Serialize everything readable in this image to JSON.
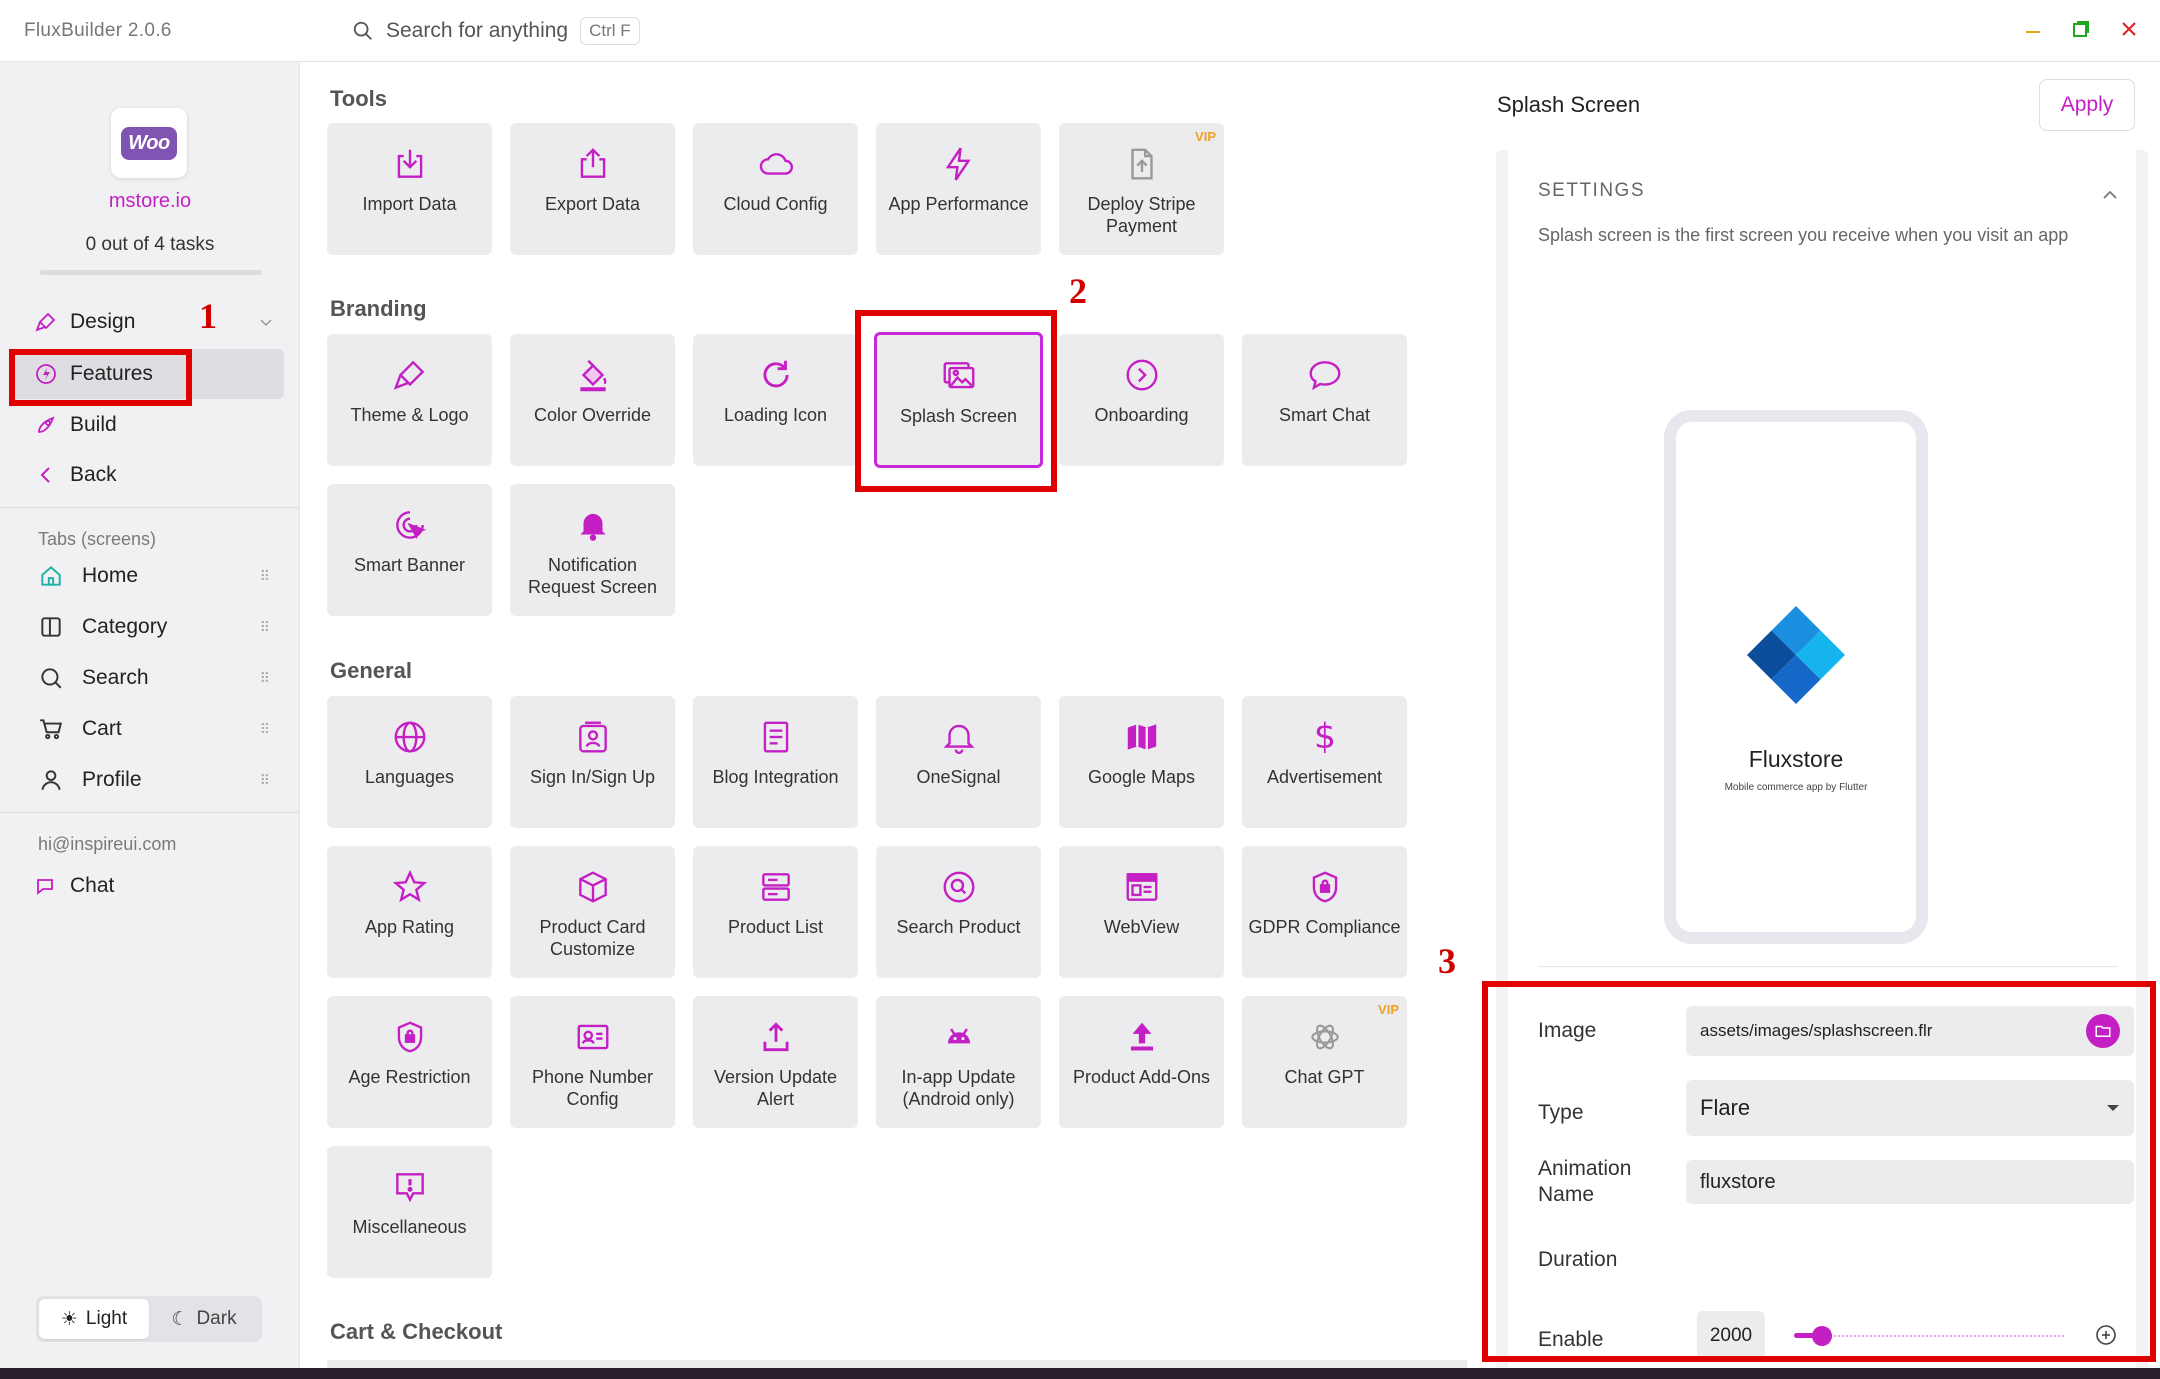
{
  "app": {
    "title": "FluxBuilder 2.0.6",
    "search_placeholder": "Search for anything",
    "search_shortcut": "Ctrl F"
  },
  "sidebar": {
    "store_name": "mstore.io",
    "tasks": "0 out of 4 tasks",
    "nav": [
      {
        "label": "Design",
        "icon": "brush-icon"
      },
      {
        "label": "Features",
        "icon": "bolt-icon",
        "active": true
      },
      {
        "label": "Build",
        "icon": "rocket-icon"
      },
      {
        "label": "Back",
        "icon": "chevron-left-icon"
      }
    ],
    "tabs_header": "Tabs (screens)",
    "tabs": [
      {
        "label": "Home",
        "icon": "home-icon"
      },
      {
        "label": "Category",
        "icon": "category-icon"
      },
      {
        "label": "Search",
        "icon": "search-icon"
      },
      {
        "label": "Cart",
        "icon": "cart-icon"
      },
      {
        "label": "Profile",
        "icon": "user-icon"
      }
    ],
    "email": "hi@inspireui.com",
    "chat_label": "Chat",
    "theme": {
      "light": "Light",
      "dark": "Dark",
      "selected": "Light"
    }
  },
  "annotations": {
    "one": "1",
    "two": "2",
    "three": "3"
  },
  "sections": {
    "tools": {
      "title": "Tools",
      "items": [
        {
          "label": "Import Data",
          "icon": "import-icon"
        },
        {
          "label": "Export Data",
          "icon": "export-icon"
        },
        {
          "label": "Cloud Config",
          "icon": "cloud-icon"
        },
        {
          "label": "App Performance",
          "icon": "bolt-icon"
        },
        {
          "label": "Deploy Stripe Payment",
          "icon": "file-upload-icon",
          "badge": "VIP"
        }
      ]
    },
    "branding": {
      "title": "Branding",
      "items": [
        {
          "label": "Theme & Logo",
          "icon": "brush-icon"
        },
        {
          "label": "Color Override",
          "icon": "paint-bucket-icon"
        },
        {
          "label": "Loading Icon",
          "icon": "refresh-icon"
        },
        {
          "label": "Splash Screen",
          "icon": "images-icon",
          "selected": true
        },
        {
          "label": "Onboarding",
          "icon": "play-circle-icon"
        },
        {
          "label": "Smart Chat",
          "icon": "chat-bubble-icon"
        },
        {
          "label": "Smart Banner",
          "icon": "cursor-click-icon"
        },
        {
          "label": "Notification Request Screen",
          "icon": "bell-icon"
        }
      ]
    },
    "general": {
      "title": "General",
      "items": [
        {
          "label": "Languages",
          "icon": "globe-icon"
        },
        {
          "label": "Sign In/Sign Up",
          "icon": "user-card-icon"
        },
        {
          "label": "Blog Integration",
          "icon": "document-icon"
        },
        {
          "label": "OneSignal",
          "icon": "bell-outline-icon"
        },
        {
          "label": "Google Maps",
          "icon": "map-icon"
        },
        {
          "label": "Advertisement",
          "icon": "dollar-icon"
        },
        {
          "label": "App Rating",
          "icon": "star-icon"
        },
        {
          "label": "Product Card Customize",
          "icon": "box-icon"
        },
        {
          "label": "Product List",
          "icon": "list-icon"
        },
        {
          "label": "Search Product",
          "icon": "search-circle-icon"
        },
        {
          "label": "WebView",
          "icon": "browser-icon"
        },
        {
          "label": "GDPR Compliance",
          "icon": "shield-lock-icon"
        },
        {
          "label": "Age Restriction",
          "icon": "shield-lock-icon"
        },
        {
          "label": "Phone Number Config",
          "icon": "contact-card-icon"
        },
        {
          "label": "Version Update Alert",
          "icon": "upload-icon"
        },
        {
          "label": "In-app Update (Android only)",
          "icon": "android-icon"
        },
        {
          "label": "Product Add-Ons",
          "icon": "upload-bold-icon"
        },
        {
          "label": "Chat GPT",
          "icon": "openai-icon",
          "badge": "VIP"
        },
        {
          "label": "Miscellaneous",
          "icon": "alert-bubble-icon"
        }
      ]
    },
    "cart_checkout": {
      "title": "Cart & Checkout"
    }
  },
  "panel": {
    "title": "Splash Screen",
    "apply_label": "Apply",
    "settings_header": "SETTINGS",
    "description": "Splash screen is the first screen you receive when you visit an app",
    "preview": {
      "brand": "Fluxstore",
      "tagline": "Mobile commerce app by Flutter"
    },
    "fields": {
      "image_label": "Image",
      "image_value": "assets/images/splashscreen.flr",
      "type_label": "Type",
      "type_value": "Flare",
      "animation_label": "Animation Name",
      "animation_value": "fluxstore",
      "duration_label": "Duration",
      "duration_value": "2000",
      "enable_label": "Enable",
      "enable_value": true
    }
  },
  "colors": {
    "accent": "#c41fc4",
    "annotation": "#e00000",
    "vip": "#f0a020"
  }
}
